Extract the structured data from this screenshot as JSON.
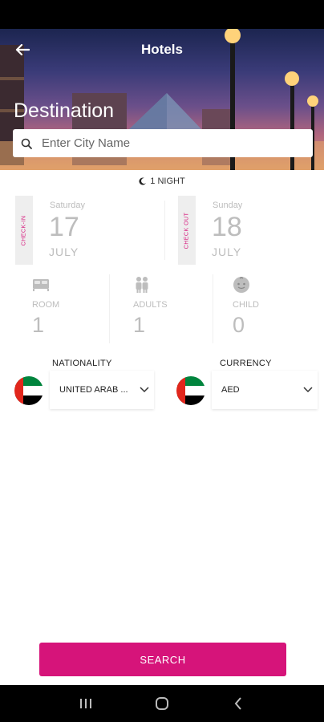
{
  "header": {
    "title": "Hotels",
    "destination_label": "Destination"
  },
  "search": {
    "placeholder": "Enter City Name",
    "value": ""
  },
  "stay": {
    "nights": "1 NIGHT"
  },
  "check_in": {
    "tag": "CHECK-IN",
    "weekday": "Saturday",
    "day": "17",
    "month": "JULY"
  },
  "check_out": {
    "tag": "CHECK OUT",
    "weekday": "Sunday",
    "day": "18",
    "month": "JULY"
  },
  "occupancy": {
    "room": {
      "label": "ROOM",
      "value": "1",
      "icon": "bed-icon"
    },
    "adults": {
      "label": "ADULTS",
      "value": "1",
      "icon": "adults-icon"
    },
    "child": {
      "label": "CHILD",
      "value": "0",
      "icon": "child-icon"
    }
  },
  "nationality": {
    "label": "NATIONALITY",
    "value": "UNITED ARAB ...",
    "flag": "uae-flag-icon"
  },
  "currency": {
    "label": "CURRENCY",
    "value": "AED",
    "flag": "uae-flag-icon"
  },
  "actions": {
    "search_label": "SEARCH"
  },
  "colors": {
    "accent": "#d6147a",
    "muted_text": "#bdbdbd"
  }
}
